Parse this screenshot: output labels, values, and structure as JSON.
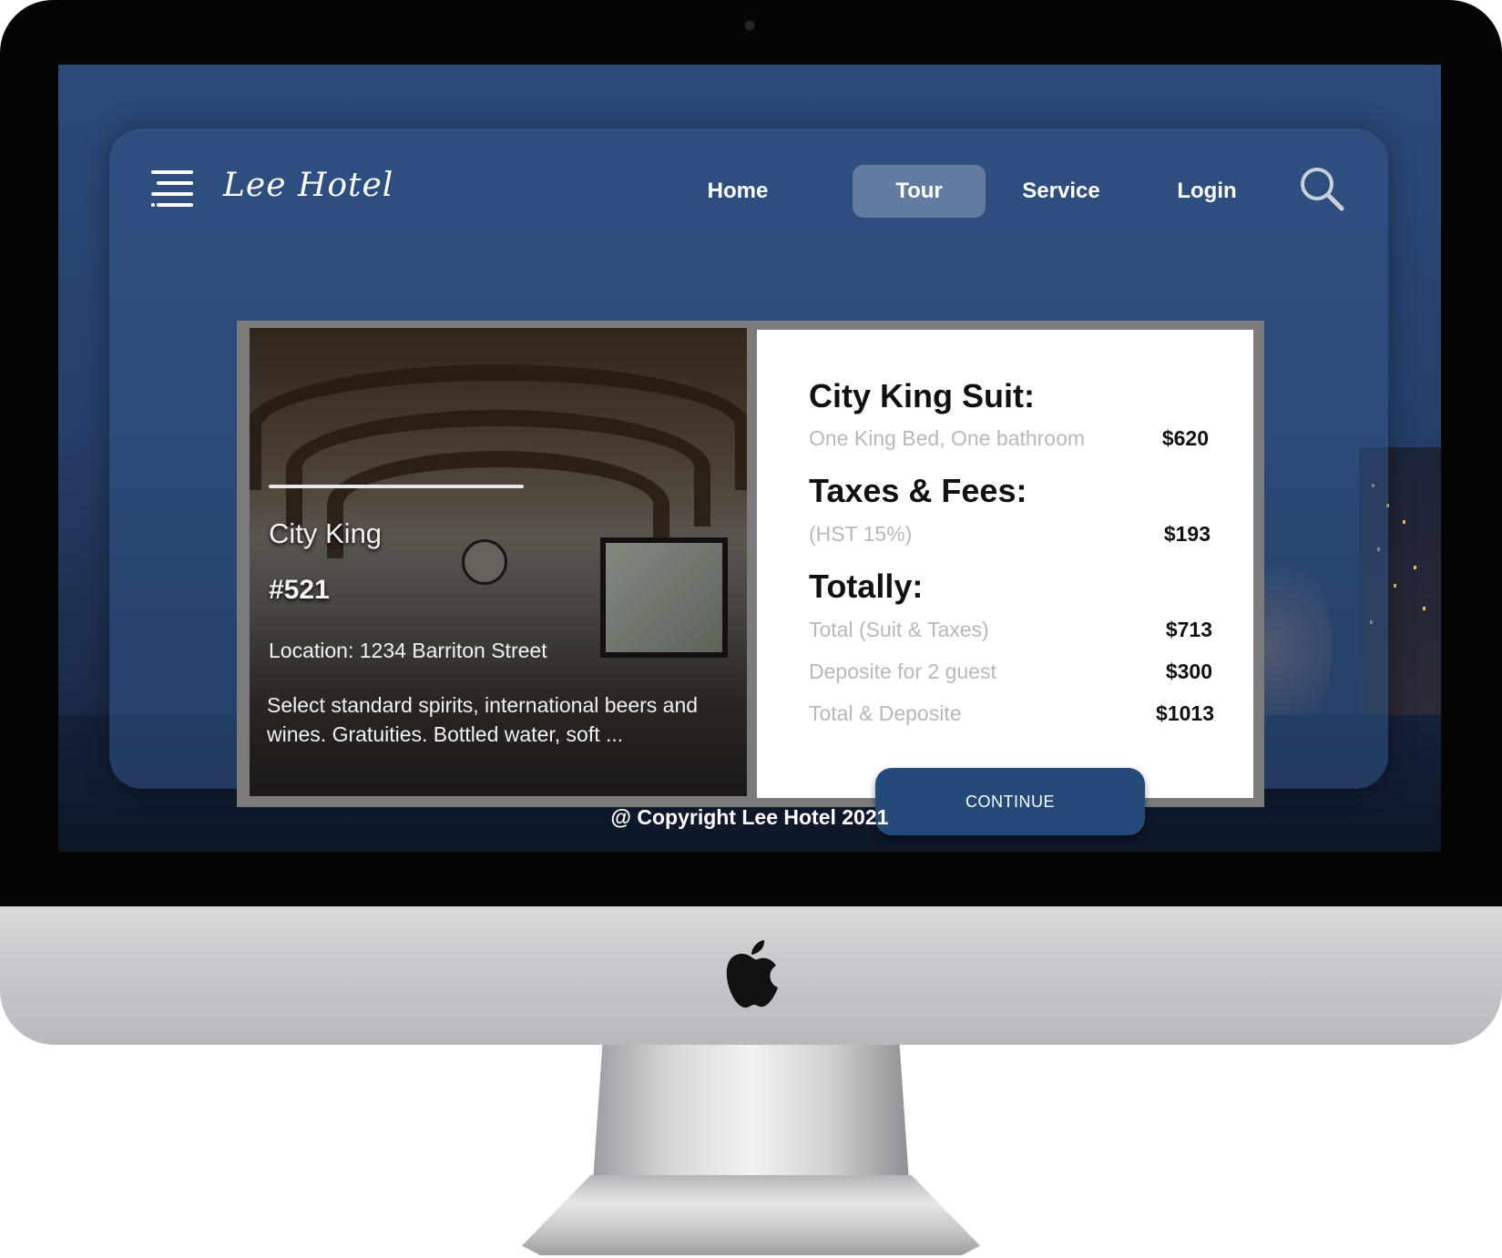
{
  "header": {
    "logo": "Lee Hotel",
    "nav": [
      {
        "label": "Home",
        "active": false
      },
      {
        "label": "Tour",
        "active": true
      },
      {
        "label": "Service",
        "active": false
      },
      {
        "label": "Login",
        "active": false
      }
    ],
    "icons": {
      "menu": "hamburger-menu-icon",
      "search": "search-icon"
    }
  },
  "room": {
    "name": "City King",
    "number": "#521",
    "location": "Location: 1234 Barriton Street",
    "description": "Select standard spirits, international beers and wines. Gratuities. Bottled water, soft ..."
  },
  "summary": {
    "suit": {
      "title": "City King Suit:",
      "label": "One King Bed, One bathroom",
      "value": "$620"
    },
    "taxes": {
      "title": "Taxes & Fees:",
      "label": "(HST 15%)",
      "value": "$193"
    },
    "totals": {
      "title": "Totally:",
      "rows": [
        {
          "label": "Total (Suit & Taxes)",
          "value": "$713"
        },
        {
          "label": "Deposite for 2 guest",
          "value": "$300"
        },
        {
          "label": "Total & Deposite",
          "value": "$1013"
        }
      ]
    }
  },
  "continue_label": "CONTINUE",
  "footer": "@ Copyright Lee Hotel 2021",
  "colors": {
    "panel": "#325587",
    "active_nav": "#8ca0be",
    "button": "#234a78"
  }
}
